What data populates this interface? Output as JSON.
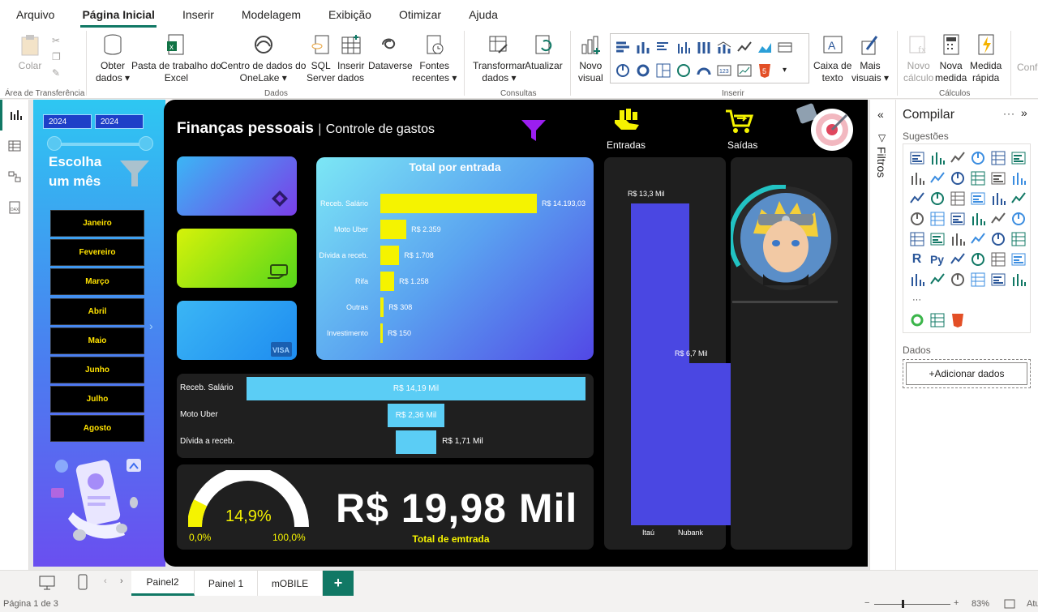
{
  "menu": [
    "Arquivo",
    "Página Inicial",
    "Inserir",
    "Modelagem",
    "Exibição",
    "Otimizar",
    "Ajuda"
  ],
  "ribbon": {
    "clipboard": {
      "colar": "Colar",
      "group": "Área de Transferência"
    },
    "dados": {
      "obter": [
        "Obter",
        "dados"
      ],
      "excel": [
        "Pasta de trabalho do",
        "Excel"
      ],
      "onelake": [
        "Centro de dados do",
        "OneLake"
      ],
      "sql": [
        "SQL",
        "Server"
      ],
      "inserir": [
        "Inserir",
        "dados"
      ],
      "dataverse": "Dataverse",
      "fontes": [
        "Fontes",
        "recentes"
      ],
      "group": "Dados"
    },
    "consultas": {
      "transformar": [
        "Transformar",
        "dados"
      ],
      "atualizar": "Atualizar",
      "group": "Consultas"
    },
    "inserir": {
      "novo_visual": [
        "Novo",
        "visual"
      ],
      "caixa": [
        "Caixa de",
        "texto"
      ],
      "mais": [
        "Mais",
        "visuais"
      ],
      "group": "Inserir"
    },
    "calculos": {
      "novo_calculo": [
        "Novo",
        "cálculo"
      ],
      "nova_medida": [
        "Nova",
        "medida"
      ],
      "medida_rapida": [
        "Medida",
        "rápida"
      ],
      "group": "Cálculos",
      "conf": "Conf"
    }
  },
  "report": {
    "years": [
      "2024",
      "2024"
    ],
    "choose": [
      "Escolha",
      "um mês"
    ],
    "months": [
      "Janeiro",
      "Fevereiro",
      "Março",
      "Abril",
      "Maio",
      "Junho",
      "Julho",
      "Agosto"
    ],
    "title": "Finanças pessoais",
    "title_sep": "|",
    "subtitle": "Controle de gastos",
    "entradas": "Entradas",
    "saidas": "Saídas",
    "chart1": {
      "title": "Total por entrada",
      "rows": [
        {
          "label": "Receb. Salário",
          "value": 14193.03,
          "text": "R$ 14.193,03"
        },
        {
          "label": "Moto Uber",
          "value": 2359,
          "text": "R$ 2.359"
        },
        {
          "label": "Dívida a receb.",
          "value": 1708,
          "text": "R$ 1.708"
        },
        {
          "label": "Rifa",
          "value": 1258,
          "text": "R$ 1.258"
        },
        {
          "label": "Outras",
          "value": 308,
          "text": "R$ 308"
        },
        {
          "label": "Investimento",
          "value": 150,
          "text": "R$ 150"
        }
      ]
    },
    "chart2": {
      "rows": [
        {
          "label": "Receb. Salário",
          "value": 14.19,
          "text": "R$ 14,19 Mil"
        },
        {
          "label": "Moto Uber",
          "value": 2.36,
          "text": "R$ 2,36 Mil"
        },
        {
          "label": "Dívida a receb.",
          "value": 1.71,
          "text": "R$ 1,71 Mil"
        }
      ]
    },
    "gauge": {
      "value": "14,9%",
      "pct": 0.149,
      "min": "0,0%",
      "max": "100,0%"
    },
    "kpi": {
      "value": "R$ 19,98 Mil",
      "label": "Total de emtrada"
    },
    "columns": [
      {
        "cat": "Itaú",
        "value": 13.3,
        "text": "R$ 13,3 Mil"
      },
      {
        "cat": "Nubank",
        "value": 6.7,
        "text": "R$ 6,7 Mil"
      }
    ]
  },
  "filters_label": "Filtros",
  "build": {
    "title": "Compilar",
    "sugestoes": "Sugestões",
    "dados": "Dados",
    "add": "+Adicionar dados"
  },
  "pages": [
    "Painel2",
    "Painel 1",
    "mOBILE"
  ],
  "status": {
    "page": "Página 1 de 3",
    "zoom": "83%",
    "at": "Atu"
  },
  "chart_data": [
    {
      "type": "bar",
      "title": "Total por entrada",
      "categories": [
        "Receb. Salário",
        "Moto Uber",
        "Dívida a receb.",
        "Rifa",
        "Outras",
        "Investimento"
      ],
      "values": [
        14193.03,
        2359,
        1708,
        1258,
        308,
        150
      ]
    },
    {
      "type": "bar",
      "categories": [
        "Receb. Salário",
        "Moto Uber",
        "Dívida a receb."
      ],
      "values": [
        14.19,
        2.36,
        1.71
      ]
    },
    {
      "type": "bar",
      "categories": [
        "Itaú",
        "Nubank"
      ],
      "values": [
        13.3,
        6.7
      ]
    }
  ]
}
